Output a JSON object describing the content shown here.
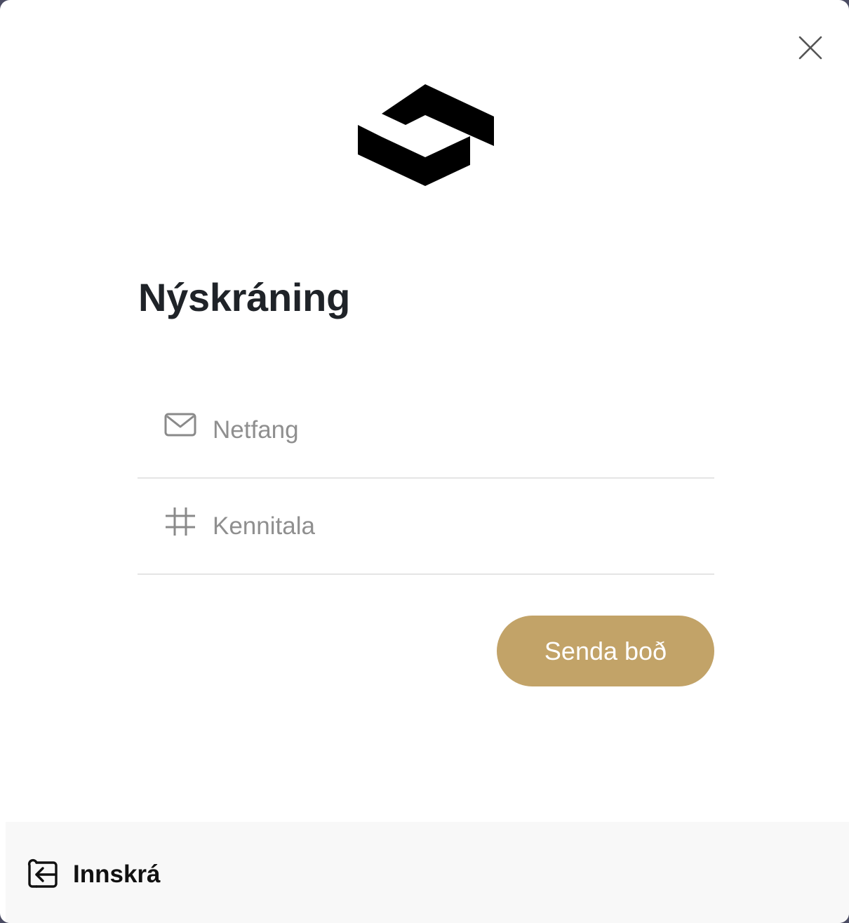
{
  "dialog": {
    "title": "Nýskráning",
    "close_icon": "close-icon",
    "logo_icon": "brand-logo"
  },
  "form": {
    "email": {
      "icon": "mail-icon",
      "placeholder": "Netfang",
      "value": ""
    },
    "kennitala": {
      "icon": "hash-icon",
      "placeholder": "Kennitala",
      "value": ""
    },
    "submit_label": "Senda boð"
  },
  "footer": {
    "login_icon": "login-icon",
    "login_label": "Innskrá"
  },
  "colors": {
    "accent": "#c2a368",
    "title": "#1f2328",
    "placeholder": "#8f8f8f",
    "divider": "#e5e5e5",
    "footer_bg": "#f8f8f8"
  }
}
